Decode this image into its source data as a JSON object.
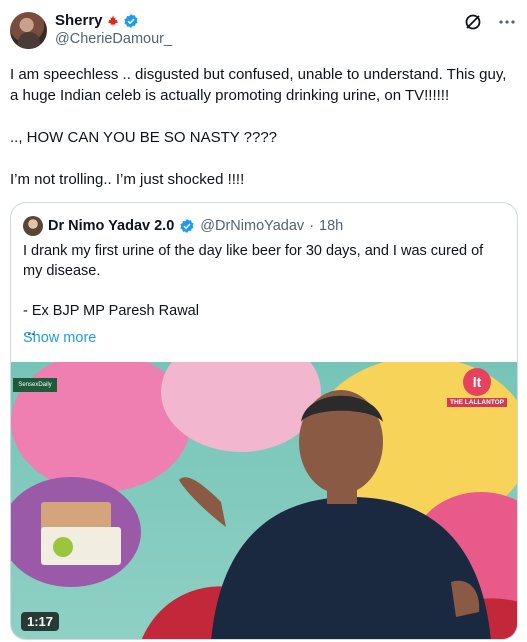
{
  "author": {
    "display_name": "Sherry",
    "flag_icon": "canada-flag-icon",
    "handle": "@CherieDamour_"
  },
  "tweet": {
    "text": "I am speechless .. disgusted but confused, unable to understand. This guy, a huge Indian celeb is actually promoting drinking urine, on TV!!!!!!\n\n.., HOW CAN YOU BE SO NASTY ????\n\nI’m not trolling.. I’m just shocked !!!!"
  },
  "quoted_tweet": {
    "display_name": "Dr Nimo Yadav 2.0",
    "handle": "@DrNimoYadav",
    "separator": "·",
    "time": "18h",
    "text": "I drank my first urine of the day like beer for 30 days, and I was cured of my disease.\n\n- Ex BJP MP Paresh Rawal\n...",
    "show_more": "Show more",
    "video": {
      "duration": "1:17",
      "brand_label": "THE LALLANTOP",
      "brand_mark": "lt",
      "sponsor_text": "SensexDaily"
    }
  },
  "colors": {
    "link": "#1d9bf0",
    "verified": "#1d9bf0",
    "secondary_text": "#536471",
    "border": "#cfd9de"
  }
}
